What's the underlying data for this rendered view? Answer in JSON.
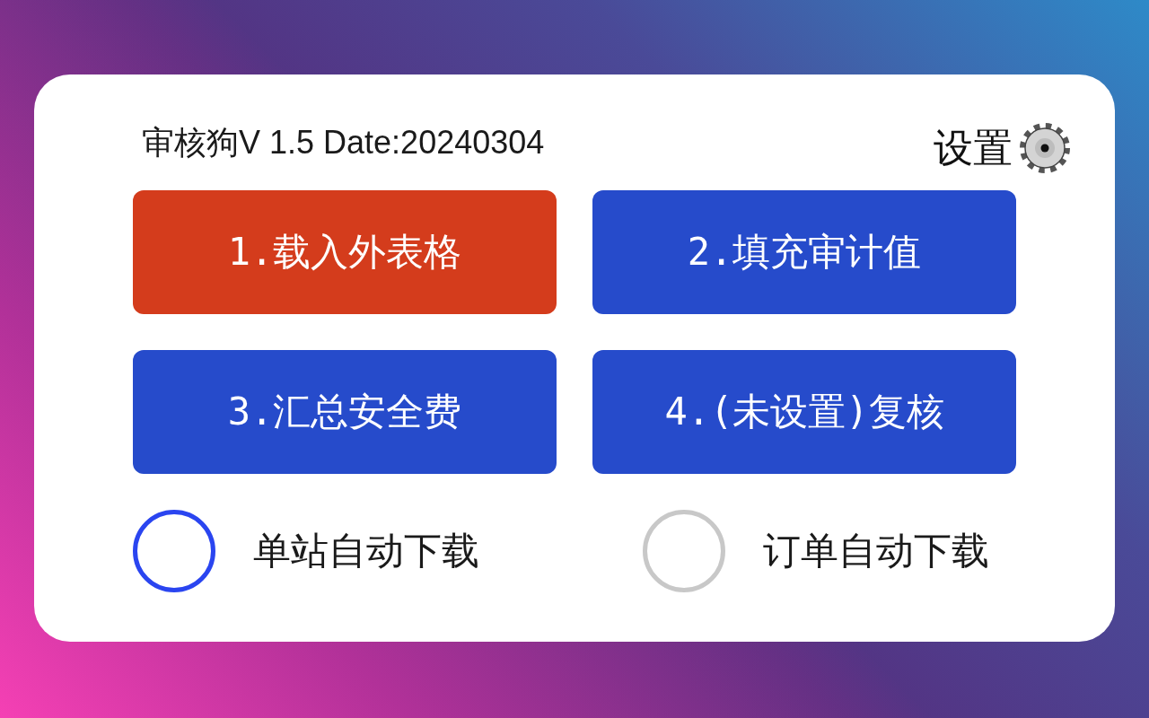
{
  "header": {
    "title": "审核狗V 1.5 Date:20240304",
    "settings_label": "设置"
  },
  "buttons": [
    {
      "label": "1.载入外表格",
      "color": "#d43c1c"
    },
    {
      "label": "2.填充审计值",
      "color": "#264bcb"
    },
    {
      "label": "3.汇总安全费",
      "color": "#264bcb"
    },
    {
      "label": "4.(未设置)复核",
      "color": "#264bcb"
    }
  ],
  "options": [
    {
      "label": "单站自动下载",
      "selected": true
    },
    {
      "label": "订单自动下载",
      "selected": false
    }
  ]
}
